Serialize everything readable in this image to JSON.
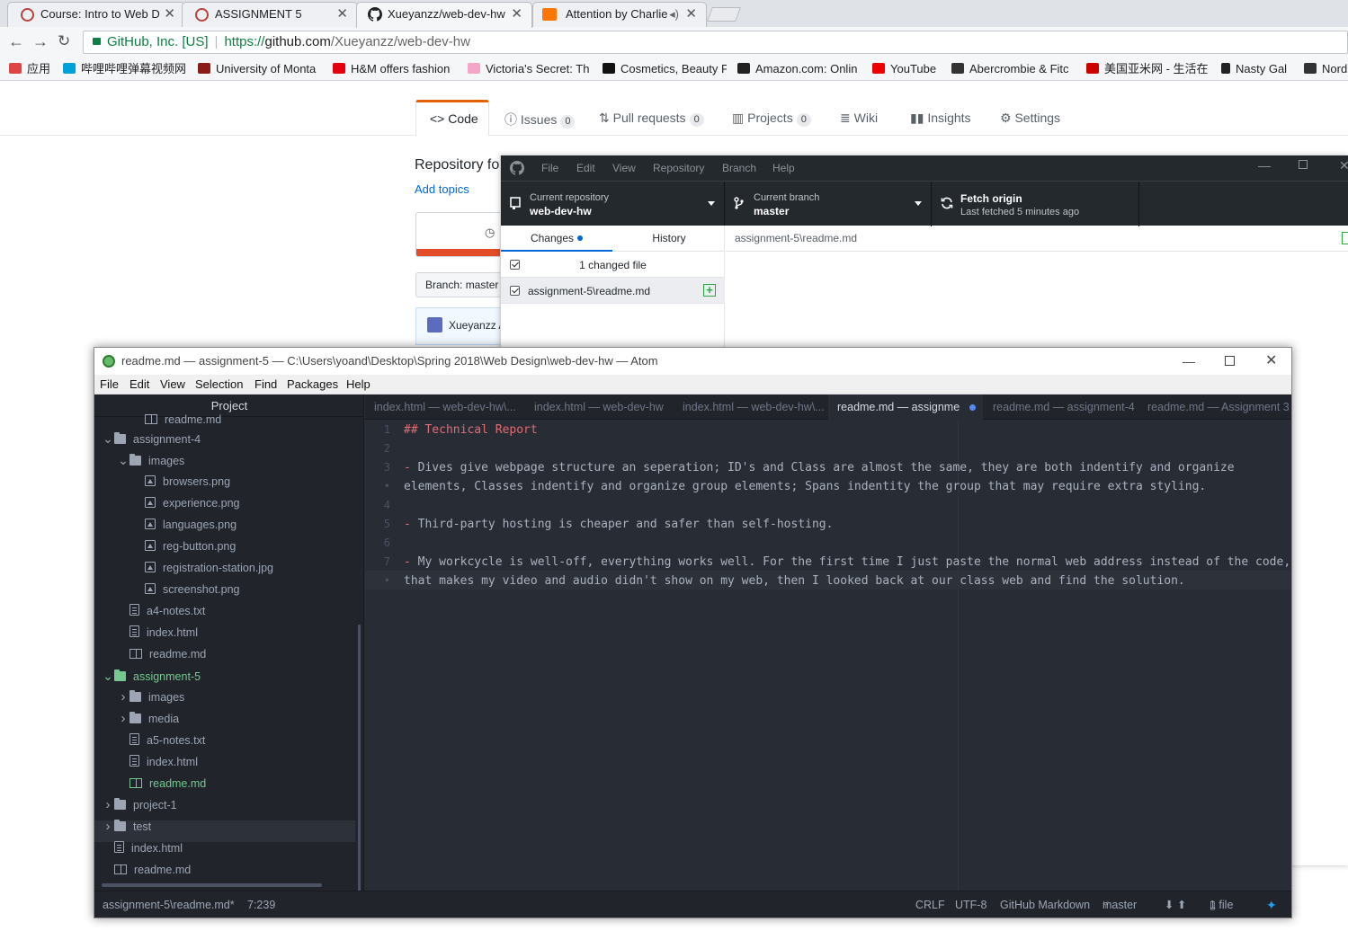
{
  "chrome": {
    "tabs": [
      {
        "title": "Course: Intro to Web D"
      },
      {
        "title": "ASSIGNMENT 5"
      },
      {
        "title": "Xueyanzz/web-dev-hw"
      },
      {
        "title": "Attention by Charlie"
      }
    ],
    "omnibox": {
      "secure_label": "GitHub, Inc. [US]",
      "scheme": "https://",
      "host": "github.com",
      "path": "/Xueyanzz/web-dev-hw"
    },
    "bookmarks": [
      {
        "label": "应用",
        "color": "#d44"
      },
      {
        "label": "哔哩哔哩弹幕视频网",
        "color": "#00a1d6"
      },
      {
        "label": "University of Monta",
        "color": "#8b1a1a"
      },
      {
        "label": "H&M offers fashion",
        "color": "#e50010"
      },
      {
        "label": "Victoria's Secret: Th",
        "color": "#f4a6c8"
      },
      {
        "label": "Cosmetics, Beauty P",
        "color": "#111"
      },
      {
        "label": "Amazon.com: Onlin",
        "color": "#222"
      },
      {
        "label": "YouTube",
        "color": "#e00"
      },
      {
        "label": "Abercrombie & Fitc",
        "color": "#333"
      },
      {
        "label": "美国亚米网 - 生活在",
        "color": "#c00"
      },
      {
        "label": "Nasty Gal",
        "color": "#222"
      },
      {
        "label": "Nord",
        "color": "#333"
      }
    ]
  },
  "github": {
    "tabs": {
      "code": "Code",
      "issues": "Issues",
      "issues_count": "0",
      "pulls": "Pull requests",
      "pulls_count": "0",
      "projects": "Projects",
      "projects_count": "0",
      "wiki": "Wiki",
      "insights": "Insights",
      "settings": "Settings"
    },
    "description": "Repository fo",
    "add_topics": "Add topics",
    "branch": "Branch: master",
    "commit_author": "Xueyanzz A"
  },
  "desktop": {
    "menu": [
      "File",
      "Edit",
      "View",
      "Repository",
      "Branch",
      "Help"
    ],
    "repo_label": "Current repository",
    "repo_value": "web-dev-hw",
    "branch_label": "Current branch",
    "branch_value": "master",
    "fetch_label": "Fetch origin",
    "fetch_sub": "Last fetched 5 minutes ago",
    "tab_changes": "Changes",
    "tab_history": "History",
    "changed_count": "1 changed file",
    "changed_file": "assignment-5\\readme.md",
    "diff_path": "assignment-5\\readme.md"
  },
  "atom": {
    "title": "readme.md — assignment-5 — C:\\Users\\yoand\\Desktop\\Spring 2018\\Web Design\\web-dev-hw — Atom",
    "menu": [
      "File",
      "Edit",
      "View",
      "Selection",
      "Find",
      "Packages",
      "Help"
    ],
    "tree_header": "Project",
    "tree": [
      {
        "label": "readme.md",
        "kind": "book",
        "depth": 3
      },
      {
        "label": "assignment-4",
        "kind": "folder",
        "depth": 1,
        "open": true
      },
      {
        "label": "images",
        "kind": "folder",
        "depth": 2,
        "open": true
      },
      {
        "label": "browsers.png",
        "kind": "img",
        "depth": 3
      },
      {
        "label": "experience.png",
        "kind": "img",
        "depth": 3
      },
      {
        "label": "languages.png",
        "kind": "img",
        "depth": 3
      },
      {
        "label": "reg-button.png",
        "kind": "img",
        "depth": 3
      },
      {
        "label": "registration-station.jpg",
        "kind": "img",
        "depth": 3
      },
      {
        "label": "screenshot.png",
        "kind": "img",
        "depth": 3
      },
      {
        "label": "a4-notes.txt",
        "kind": "file",
        "depth": 2
      },
      {
        "label": "index.html",
        "kind": "file",
        "depth": 2
      },
      {
        "label": "readme.md",
        "kind": "book",
        "depth": 2
      },
      {
        "label": "assignment-5",
        "kind": "folder",
        "depth": 1,
        "open": true,
        "green": true
      },
      {
        "label": "images",
        "kind": "folder",
        "depth": 2,
        "open": false
      },
      {
        "label": "media",
        "kind": "folder",
        "depth": 2,
        "open": false
      },
      {
        "label": "a5-notes.txt",
        "kind": "file",
        "depth": 2
      },
      {
        "label": "index.html",
        "kind": "file",
        "depth": 2
      },
      {
        "label": "readme.md",
        "kind": "book",
        "depth": 2,
        "green": true,
        "selected": true
      },
      {
        "label": "project-1",
        "kind": "folder",
        "depth": 1,
        "open": false
      },
      {
        "label": "test",
        "kind": "folder",
        "depth": 1,
        "open": false
      },
      {
        "label": "index.html",
        "kind": "file",
        "depth": 1
      },
      {
        "label": "readme.md",
        "kind": "book",
        "depth": 1
      }
    ],
    "tabs": [
      {
        "label": "index.html — web-dev-hw\\..."
      },
      {
        "label": "index.html — web-dev-hw"
      },
      {
        "label": "index.html — web-dev-hw\\..."
      },
      {
        "label": "readme.md — assignment-5",
        "active": true,
        "modified": true
      },
      {
        "label": "readme.md — assignment-4"
      },
      {
        "label": "readme.md — Assignment 3"
      }
    ],
    "lines": [
      {
        "num": "1",
        "text": "## Technical Report",
        "heading": true
      },
      {
        "num": "2",
        "text": ""
      },
      {
        "num": "3",
        "text": "- Dives give webpage structure an seperation; ID's and Class are almost the same, they are both indentify and organize"
      },
      {
        "num": "•",
        "text": "elements, Classes indentify and organize group elements; Spans indentity the group that may require extra styling."
      },
      {
        "num": "4",
        "text": ""
      },
      {
        "num": "5",
        "text": "- Third-party hosting is cheaper and safer than self-hosting."
      },
      {
        "num": "6",
        "text": ""
      },
      {
        "num": "7",
        "text": "- My workcycle is well-off, everything works well. For the first time I just paste the normal web address instead of the code,"
      },
      {
        "num": "•",
        "text": "that makes my video and audio didn't show on my web, then I looked back at our class web and find the solution."
      }
    ],
    "status": {
      "file": "assignment-5\\readme.md*",
      "cursor": "7:239",
      "line_ending": "CRLF",
      "encoding": "UTF-8",
      "grammar": "GitHub Markdown",
      "branch": "master",
      "files": "1 file"
    }
  }
}
